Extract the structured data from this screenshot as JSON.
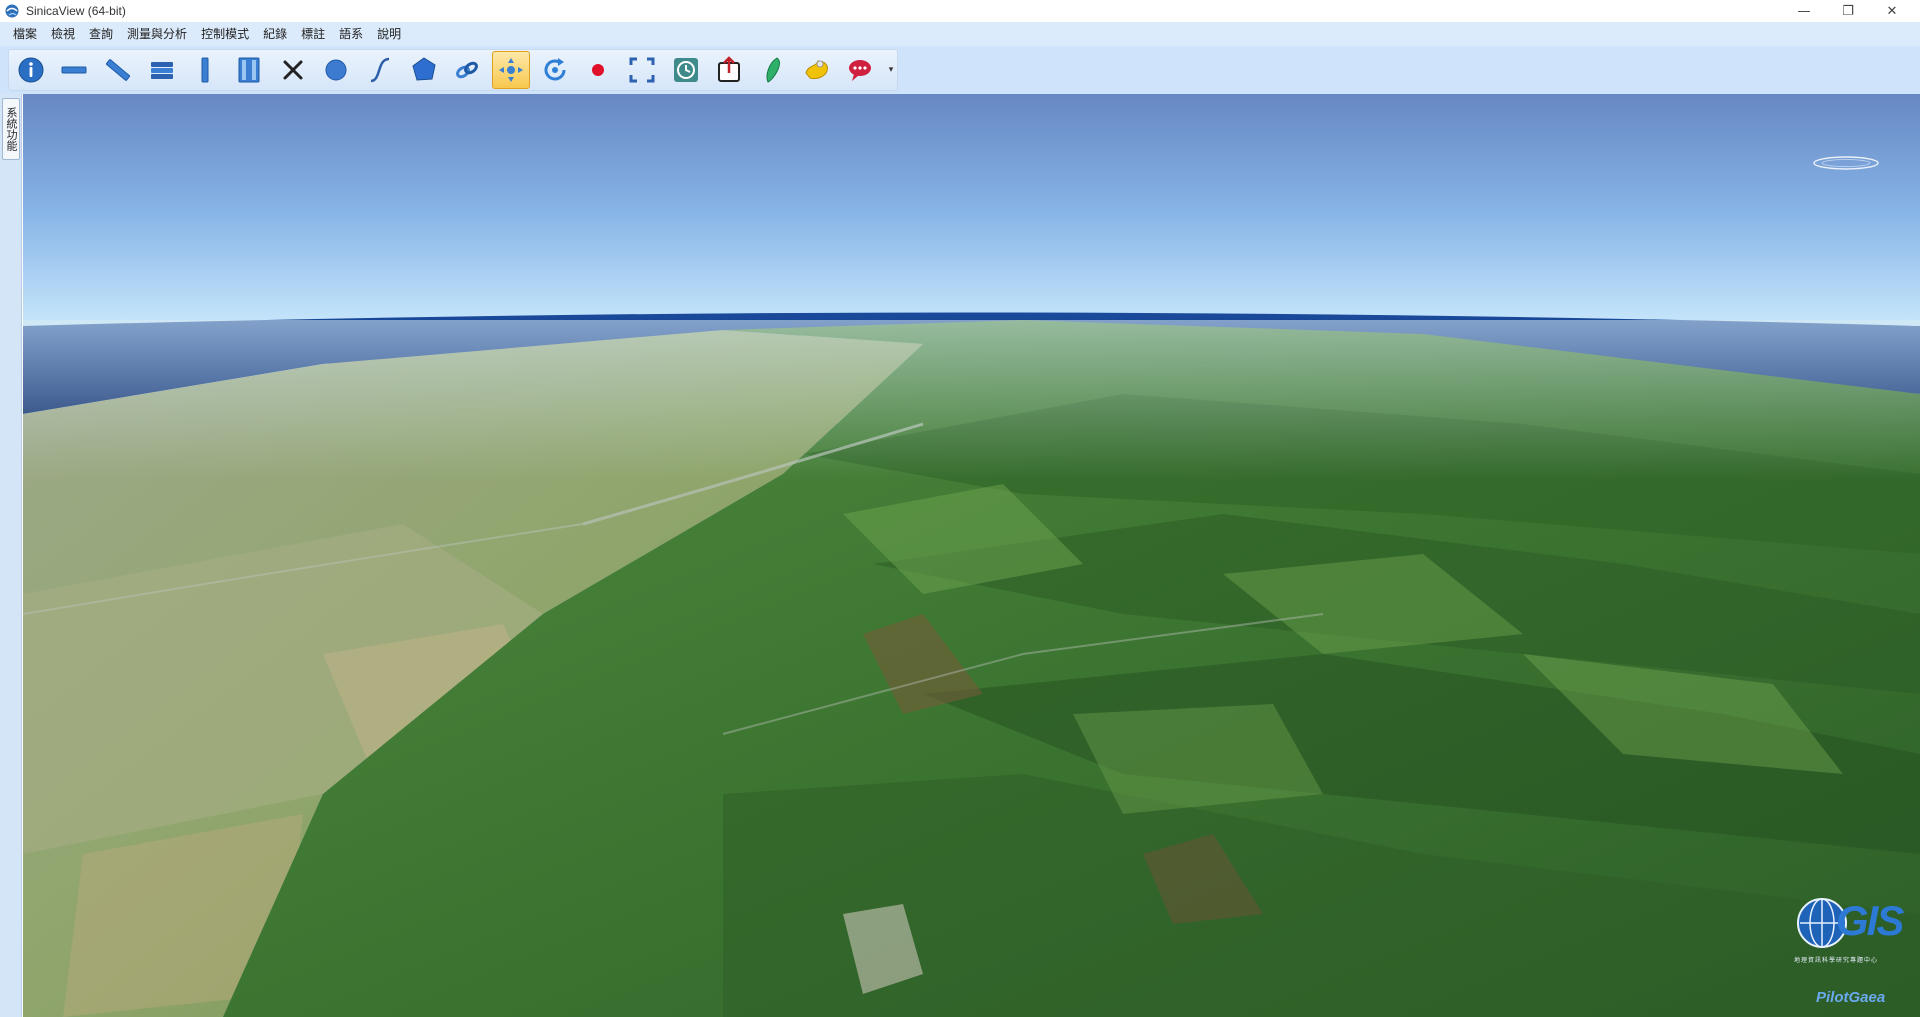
{
  "window": {
    "title": "SinicaView (64-bit)",
    "controls": {
      "minimize": "—",
      "restore": "❐",
      "close": "✕"
    }
  },
  "menu": {
    "items": [
      {
        "label": "檔案"
      },
      {
        "label": "檢視"
      },
      {
        "label": "查詢"
      },
      {
        "label": "測量與分析"
      },
      {
        "label": "控制模式"
      },
      {
        "label": "紀錄"
      },
      {
        "label": "標註"
      },
      {
        "label": "語系"
      },
      {
        "label": "說明"
      }
    ]
  },
  "toolbar": {
    "buttons": [
      {
        "icon": "info-icon",
        "color": "#2b6fc4"
      },
      {
        "icon": "horizontal-bar-icon",
        "color": "#3a7fd2"
      },
      {
        "icon": "diagonal-ruler-icon",
        "color": "#3a7fd2"
      },
      {
        "icon": "stacked-layers-icon",
        "color": "#2c62b0"
      },
      {
        "icon": "vertical-bar-icon",
        "color": "#3a7fd2"
      },
      {
        "icon": "split-panel-icon",
        "color": "#3a7fd2"
      },
      {
        "icon": "close-x-icon",
        "color": "#222222"
      },
      {
        "icon": "circle-icon",
        "color": "#3d7bd0"
      },
      {
        "icon": "curve-line-icon",
        "color": "#2c5fa8"
      },
      {
        "icon": "polygon-icon",
        "color": "#2f6ed1"
      },
      {
        "icon": "link-chain-icon",
        "color": "#3a7fd2"
      },
      {
        "icon": "pan-navigate-icon",
        "color": "#3a7fd2",
        "active": true
      },
      {
        "icon": "rotate-icon",
        "color": "#2f7fd6"
      },
      {
        "icon": "record-icon",
        "color": "#e0102a"
      },
      {
        "icon": "fullscreen-icon",
        "color": "#2c62b0"
      },
      {
        "icon": "history-clock-icon",
        "color": "#3f8a8a"
      },
      {
        "icon": "export-icon",
        "color": "#c0202a"
      },
      {
        "icon": "leaf-taiwan-icon",
        "color": "#2fb06a"
      },
      {
        "icon": "map-region-icon",
        "color": "#f1c20a"
      },
      {
        "icon": "chat-bubble-icon",
        "color": "#d02040"
      }
    ],
    "dropdown": "▾"
  },
  "side_panel": {
    "tab_label": "系統功能"
  },
  "viewport": {
    "logo": {
      "text": "GIS",
      "caption": "地理資訊科學研究專題中心",
      "brand": "PilotGaea"
    }
  }
}
